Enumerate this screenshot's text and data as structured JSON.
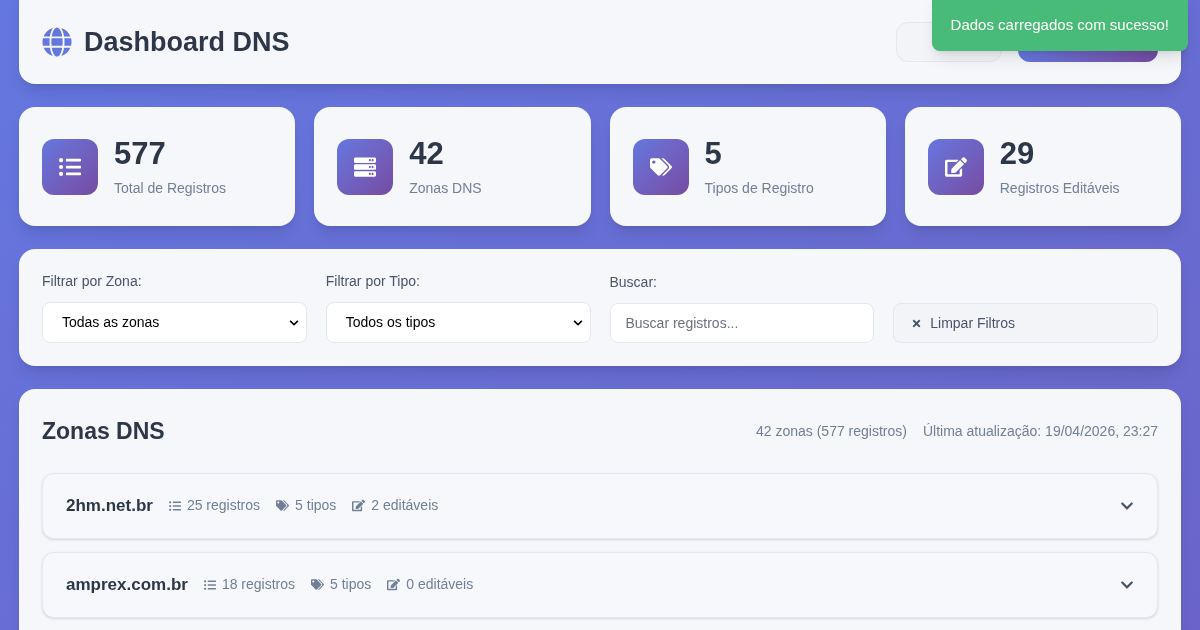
{
  "header": {
    "title": "Dashboard DNS"
  },
  "toast": {
    "message": "Dados carregados com sucesso!"
  },
  "stats": [
    {
      "kind": "list",
      "value": "577",
      "label": "Total de Registros"
    },
    {
      "kind": "server",
      "value": "42",
      "label": "Zonas DNS"
    },
    {
      "kind": "tags",
      "value": "5",
      "label": "Tipos de Registro"
    },
    {
      "kind": "edit",
      "value": "29",
      "label": "Registros Editáveis"
    }
  ],
  "filters": {
    "zone": {
      "label": "Filtrar por Zona:",
      "value": "Todas as zonas"
    },
    "type": {
      "label": "Filtrar por Tipo:",
      "value": "Todos os tipos"
    },
    "search": {
      "label": "Buscar:",
      "placeholder": "Buscar registros..."
    },
    "clear_button": "Limpar Filtros"
  },
  "zones_panel": {
    "title": "Zonas DNS",
    "summary": "42 zonas (577 registros)",
    "updated": "Última atualização: 19/04/2026, 23:27",
    "zones": [
      {
        "name": "2hm.net.br",
        "records": "25 registros",
        "types": "5 tipos",
        "editable": "2 editáveis",
        "expanded": false
      },
      {
        "name": "amprex.com.br",
        "records": "18 registros",
        "types": "5 tipos",
        "editable": "0 editáveis",
        "expanded": false
      }
    ]
  }
}
